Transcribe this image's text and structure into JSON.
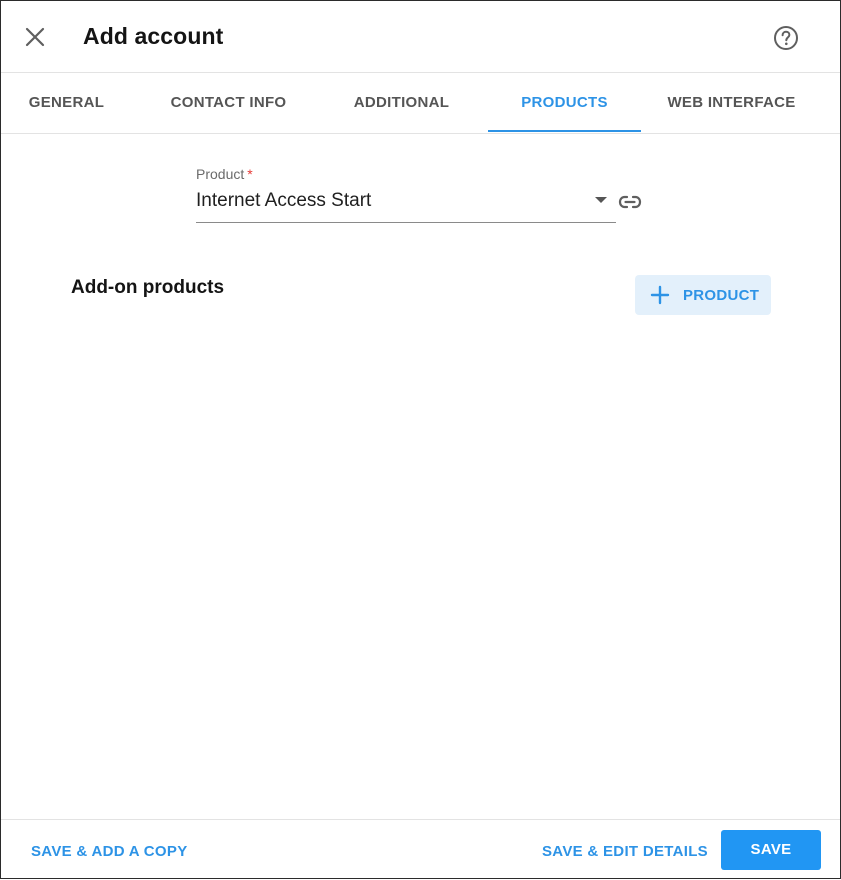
{
  "dialog": {
    "title": "Add account",
    "close_icon": "close-icon",
    "help_icon": "help-circle-icon"
  },
  "tabs": [
    {
      "label": "GENERAL"
    },
    {
      "label": "CONTACT INFO"
    },
    {
      "label": "ADDITIONAL"
    },
    {
      "label": "PRODUCTS",
      "active": true
    },
    {
      "label": "WEB INTERFACE"
    }
  ],
  "product_field": {
    "label": "Product",
    "required_mark": "*",
    "value": "Internet Access Start",
    "link_icon": "link-icon"
  },
  "addon": {
    "title": "Add-on products",
    "add_button_label": "PRODUCT",
    "add_icon": "plus-icon"
  },
  "footer": {
    "save_add_copy": "SAVE & ADD A COPY",
    "save_edit_details": "SAVE & EDIT DETAILS",
    "save": "SAVE"
  },
  "colors": {
    "accent": "#2d93e6",
    "primary_button": "#2196f3",
    "secondary_button_bg": "#e3f0fb",
    "required": "#e53935"
  }
}
